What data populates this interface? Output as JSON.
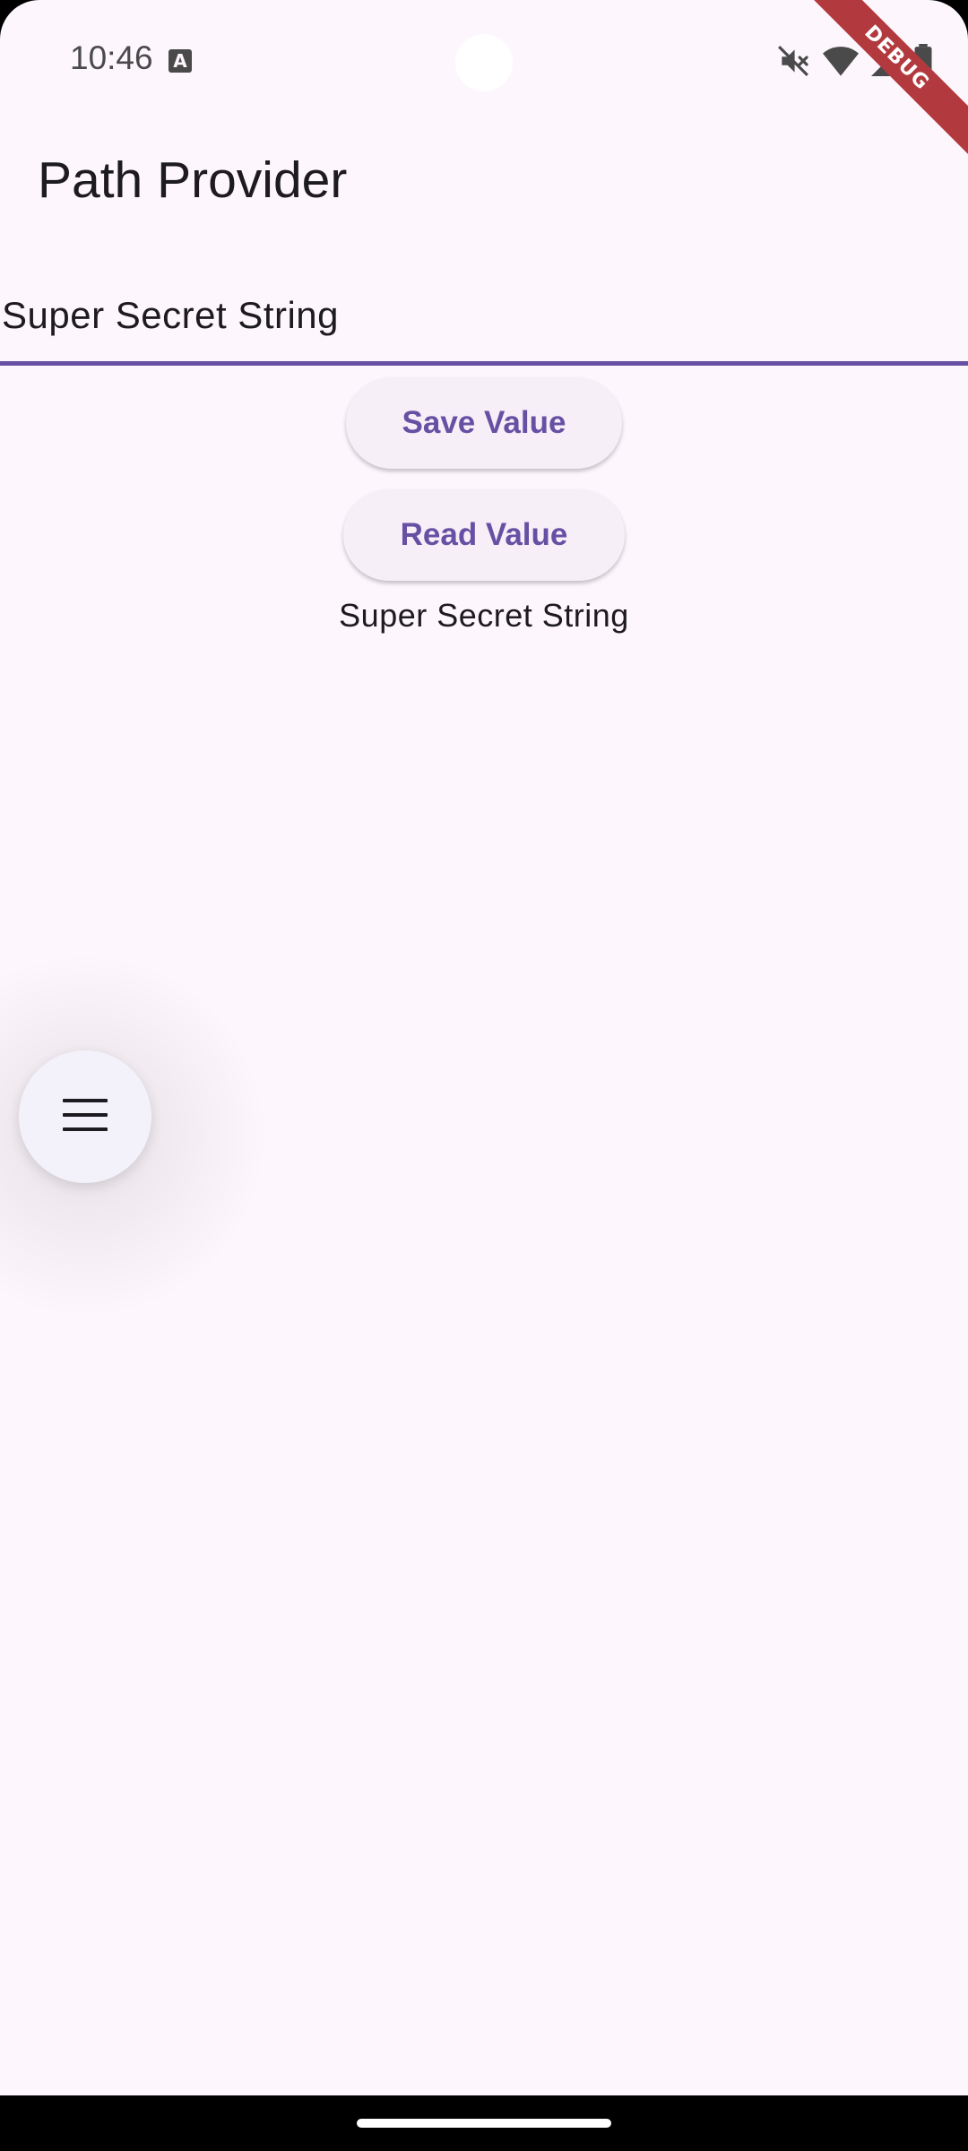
{
  "status_bar": {
    "time": "10:46",
    "icons": [
      "text-input-icon",
      "mute-icon",
      "wifi-icon",
      "signal-icon",
      "battery-icon"
    ]
  },
  "debug_banner": "DEBUG",
  "app_bar": {
    "title": "Path Provider"
  },
  "form": {
    "input_value": "Super Secret String"
  },
  "actions": {
    "save_label": "Save Value",
    "read_label": "Read Value"
  },
  "result": {
    "text": "Super Secret String"
  },
  "fab": {
    "icon": "menu-icon"
  },
  "colors": {
    "background": "#fdf6fd",
    "accent": "#6750a4",
    "button_bg": "#f6eff7",
    "debug_ribbon": "#b23a3f"
  }
}
